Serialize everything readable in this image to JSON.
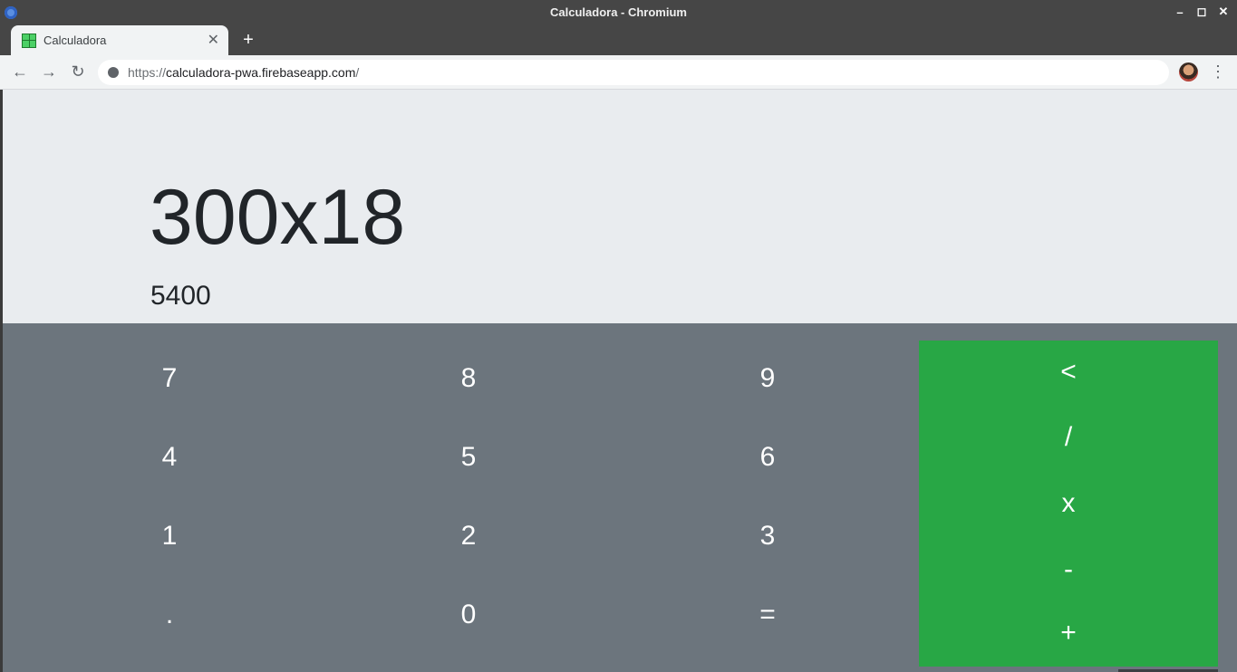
{
  "window": {
    "title": "Calculadora - Chromium"
  },
  "tab": {
    "title": "Calculadora"
  },
  "address_bar": {
    "url_scheme": "https://",
    "url_host": "calculadora-pwa.firebaseapp.com",
    "url_path": "/"
  },
  "colors": {
    "display_bg": "#e9ecef",
    "keypad_bg": "#6c757d",
    "operator_bg": "#28a745",
    "text_dark": "#212529"
  },
  "display": {
    "expression": "300x18",
    "result": "5400"
  },
  "keys": {
    "row1": [
      "7",
      "8",
      "9"
    ],
    "row2": [
      "4",
      "5",
      "6"
    ],
    "row3": [
      "1",
      "2",
      "3"
    ],
    "row4": [
      ".",
      "0",
      "="
    ]
  },
  "operators": [
    "<",
    "/",
    "x",
    "-",
    "+"
  ]
}
